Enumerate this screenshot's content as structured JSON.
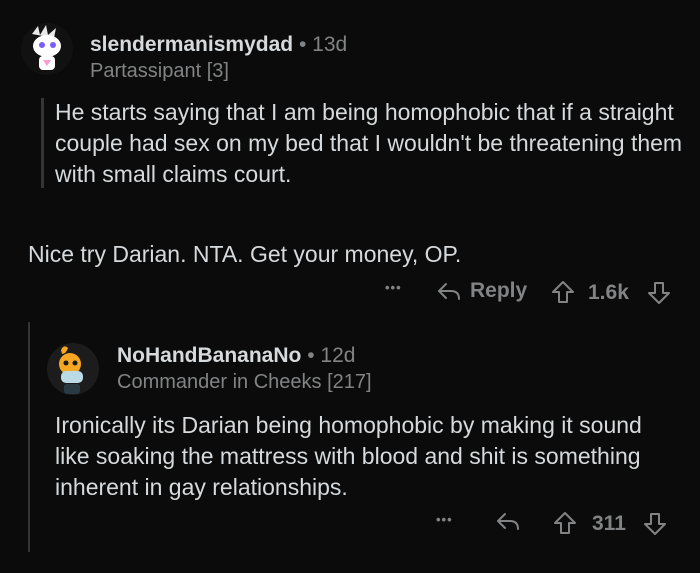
{
  "comment1": {
    "username": "slendermanismydad",
    "separator": "•",
    "time": "13d",
    "flair": "Partassipant [3]",
    "quote": "He starts saying that I am being homophobic that if a straight couple had sex on my bed that I wouldn't be threatening them with small claims court.",
    "text": "Nice try Darian. NTA. Get your money, OP.",
    "actions": {
      "more": "•••",
      "reply": "Reply",
      "score": "1.6k"
    }
  },
  "comment2": {
    "username": "NoHandBananaNo",
    "separator": "•",
    "time": "12d",
    "flair": "Commander in Cheeks [217]",
    "text": "Ironically its Darian being homophobic by making it sound like soaking the mattress with blood and shit is something inherent in gay relationships.",
    "actions": {
      "more": "•••",
      "score": "311"
    }
  }
}
